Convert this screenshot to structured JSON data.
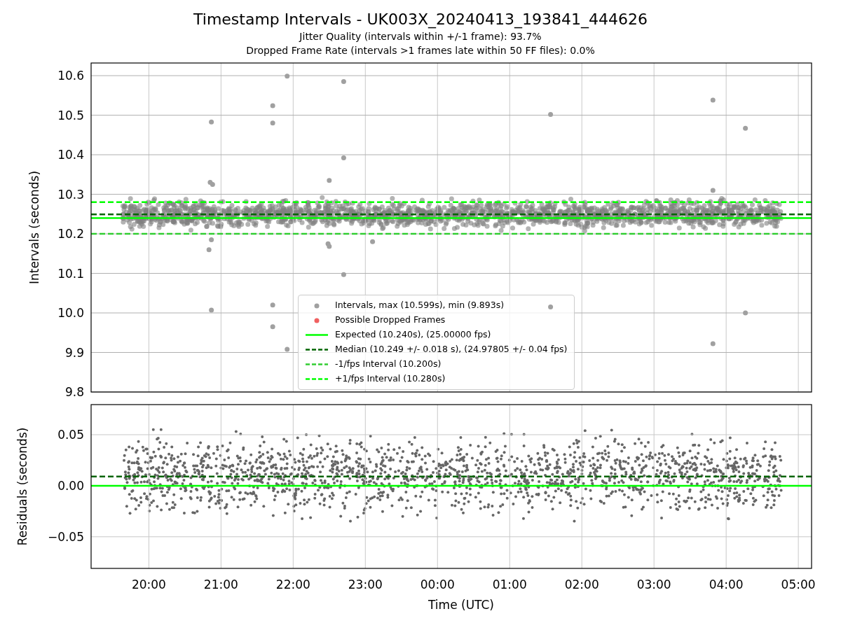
{
  "figure": {
    "title": "Timestamp Intervals - UK003X_20240413_193841_444626",
    "subtitles": [
      "Jitter Quality (intervals within +/-1 frame): 93.7%",
      "Dropped Frame Rate (intervals >1 frames late within 50 FF files): 0.0%"
    ]
  },
  "intervals_plot": {
    "legend": [
      {
        "label": "Intervals, max (10.599s), min (9.893s)",
        "kind": "marker",
        "color": "#a0a0a0"
      },
      {
        "label": "Possible Dropped Frames",
        "kind": "marker",
        "color": "#f06060"
      },
      {
        "label": "Expected (10.240s), (25.00000 fps)",
        "kind": "line",
        "color": "#00ff00",
        "dashed": false
      },
      {
        "label": "Median (10.249 +/- 0.018 s), (24.97805 +/- 0.04 fps)",
        "kind": "line",
        "color": "#006400",
        "dashed": true
      },
      {
        "label": "-1/fps Interval (10.200s)",
        "kind": "line",
        "color": "#32cd32",
        "dashed": true
      },
      {
        "label": "+1/fps Interval (10.280s)",
        "kind": "line",
        "color": "#00ff00",
        "dashed": true
      }
    ],
    "chart_data": {
      "type": "scatter",
      "ylabel": "Intervals (seconds)",
      "grid": true,
      "xlim": [
        "2024-04-13T19:12",
        "2024-04-14T05:11"
      ],
      "ylim": [
        9.8,
        10.632
      ],
      "yticks": [
        {
          "value": 9.8,
          "label": "9.8"
        },
        {
          "value": 9.9,
          "label": "9.9"
        },
        {
          "value": 10.0,
          "label": "10.0"
        },
        {
          "value": 10.1,
          "label": "10.1"
        },
        {
          "value": 10.2,
          "label": "10.2"
        },
        {
          "value": 10.3,
          "label": "10.3"
        },
        {
          "value": 10.4,
          "label": "10.4"
        },
        {
          "value": 10.5,
          "label": "10.5"
        },
        {
          "value": 10.6,
          "label": "10.6"
        }
      ],
      "x": [
        "2024-04-13T20:52",
        "2024-04-13T20:51",
        "2024-04-13T20:53",
        "2024-04-13T20:52",
        "2024-04-13T20:50",
        "2024-04-13T20:52",
        "2024-04-13T21:43",
        "2024-04-13T21:43",
        "2024-04-13T21:43",
        "2024-04-13T21:43",
        "2024-04-13T21:55",
        "2024-04-13T21:55",
        "2024-04-13T22:30",
        "2024-04-13T22:29",
        "2024-04-13T22:30",
        "2024-04-13T22:42",
        "2024-04-13T22:42",
        "2024-04-13T22:42",
        "2024-04-13T23:06",
        "2024-04-14T01:34",
        "2024-04-14T01:34",
        "2024-04-14T03:49",
        "2024-04-14T03:49",
        "2024-04-14T03:49",
        "2024-04-14T04:16",
        "2024-04-14T04:16"
      ],
      "series": [
        {
          "color": "#a0a0a0",
          "values": [
            10.483,
            10.33,
            10.325,
            10.185,
            10.16,
            10.007,
            10.524,
            10.48,
            10.02,
            9.965,
            10.599,
            9.908,
            10.335,
            10.175,
            10.168,
            10.585,
            10.392,
            10.097,
            10.18,
            10.502,
            10.015,
            10.538,
            10.31,
            9.922,
            10.467,
            10.0
          ]
        }
      ],
      "ref_lines": [
        {
          "axis": "y",
          "value": 10.24,
          "color": "#00ff00"
        },
        {
          "axis": "y",
          "value": 10.249,
          "color": "#006400"
        },
        {
          "axis": "y",
          "value": 10.2,
          "color": "#32cd32"
        },
        {
          "axis": "y",
          "value": 10.28,
          "color": "#00ff00"
        }
      ]
    }
  },
  "residuals_plot": {
    "chart_data": {
      "type": "scatter",
      "xlabel": "Time (UTC)",
      "ylabel": "Residuals (seconds)",
      "grid": true,
      "xlim": [
        "2024-04-13T19:12",
        "2024-04-14T05:11"
      ],
      "ylim": [
        -0.081,
        0.0795
      ],
      "xticks": [
        {
          "value": "2024-04-13T20:00",
          "label": "20:00"
        },
        {
          "value": "2024-04-13T21:00",
          "label": "21:00"
        },
        {
          "value": "2024-04-13T22:00",
          "label": "22:00"
        },
        {
          "value": "2024-04-13T23:00",
          "label": "23:00"
        },
        {
          "value": "2024-04-14T00:00",
          "label": "00:00"
        },
        {
          "value": "2024-04-14T01:00",
          "label": "01:00"
        },
        {
          "value": "2024-04-14T02:00",
          "label": "02:00"
        },
        {
          "value": "2024-04-14T03:00",
          "label": "03:00"
        },
        {
          "value": "2024-04-14T04:00",
          "label": "04:00"
        },
        {
          "value": "2024-04-14T05:00",
          "label": "05:00"
        }
      ],
      "yticks": [
        {
          "value": -0.05,
          "label": "−0.05"
        },
        {
          "value": 0,
          "label": "0.00"
        },
        {
          "value": 0.05,
          "label": "0.05"
        }
      ],
      "ref_lines": [
        {
          "axis": "y",
          "value": 0.009,
          "color": "#006400"
        },
        {
          "axis": "y",
          "value": 0,
          "color": "#00ff00"
        }
      ]
    }
  }
}
